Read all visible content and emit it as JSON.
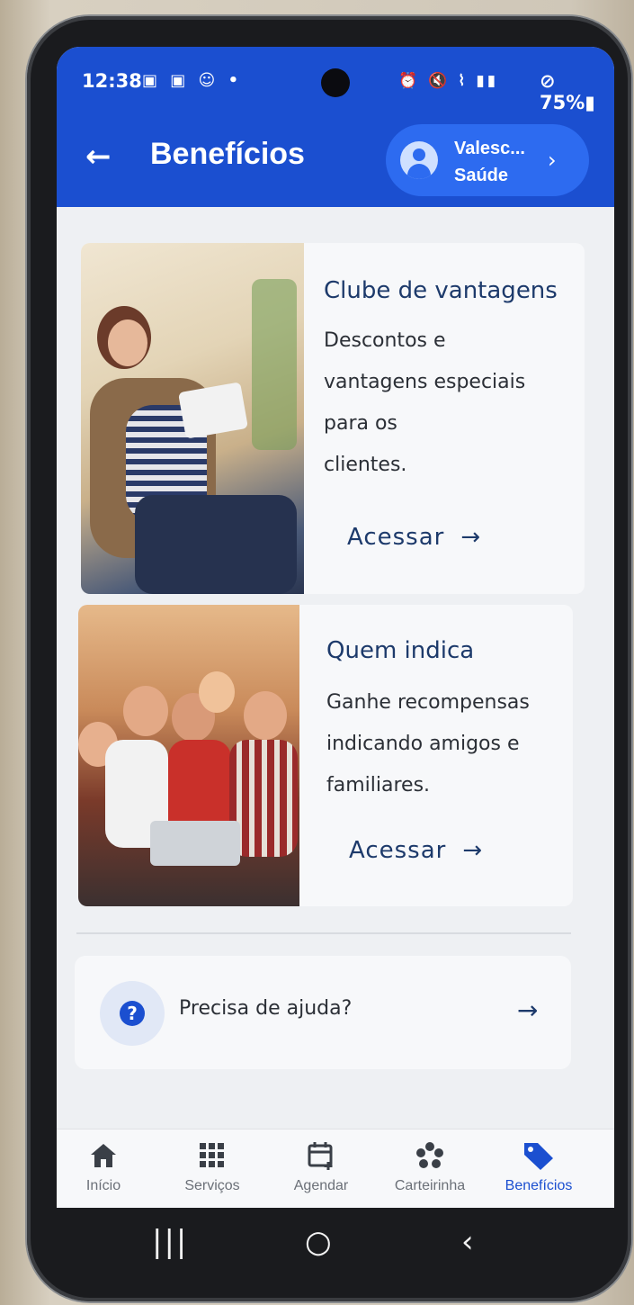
{
  "status_bar": {
    "time": "12:38",
    "left_icons": "▣ ▣ ☺ •",
    "right_icons": "⏰ 🔇 ⌇ ▮▮",
    "battery": "⊘ 75%▮"
  },
  "header": {
    "back_icon": "←",
    "title": "Benefícios",
    "profile": {
      "name": "Valesc...",
      "plan": "Saúde",
      "chevron": "›"
    }
  },
  "cards": [
    {
      "title": "Clube de vantagens",
      "description_lines": [
        "Descontos e",
        "vantagens especiais",
        "para os",
        "clientes."
      ],
      "link_label": "Acessar",
      "link_arrow": "→"
    },
    {
      "title": "Quem indica",
      "description_lines": [
        "Ganhe recompensas",
        "indicando amigos e",
        "familiares."
      ],
      "link_label": "Acessar",
      "link_arrow": "→"
    }
  ],
  "help": {
    "icon": "?",
    "label": "Precisa de ajuda?",
    "arrow": "→"
  },
  "bottom_nav": {
    "items": [
      {
        "label": "Início",
        "icon": "home-icon"
      },
      {
        "label": "Serviços",
        "icon": "grid-icon"
      },
      {
        "label": "Agendar",
        "icon": "calendar-add-icon"
      },
      {
        "label": "Carteirinha",
        "icon": "card-icon"
      },
      {
        "label": "Benefícios",
        "icon": "tag-icon"
      }
    ],
    "active_index": 4
  },
  "system_nav": {
    "recents": "|||",
    "home": "○",
    "back": "‹"
  },
  "colors": {
    "primary": "#1b4fd0",
    "chip": "#2d6bf0",
    "title_text": "#1d3a6b",
    "background": "#eef0f3"
  }
}
